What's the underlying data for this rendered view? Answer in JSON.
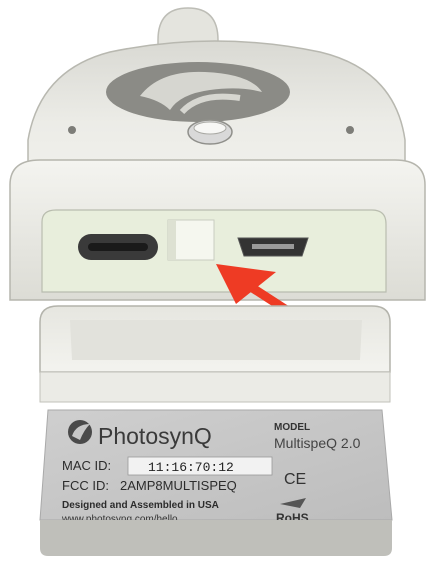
{
  "device": {
    "brand": "PhotosynQ",
    "model_label": "MODEL",
    "model_name": "MultispeQ 2.0",
    "mac_label": "MAC ID:",
    "mac_value": "11:16:70:12",
    "fcc_label": "FCC ID:",
    "fcc_value": "2AMP8MULTISPEQ",
    "made_in": "Designed and Assembled in USA",
    "url": "www.photosynq.com/hello",
    "ce_mark": "CE",
    "rohs_mark": "RoHS"
  },
  "annotation": {
    "arrow_color": "#ee3b24"
  },
  "colors": {
    "housing": "#e9e9e4",
    "housing_shadow": "#c9c9c2",
    "port_panel": "#e6ecdc",
    "label_bg": "#c7c7c7"
  }
}
